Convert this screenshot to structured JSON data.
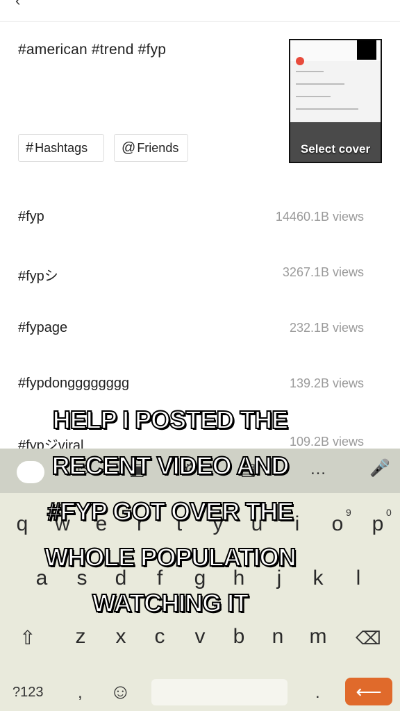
{
  "caption": "#american #trend #fyp",
  "cover": {
    "label": "Select cover"
  },
  "chips": {
    "hashtags": "Hashtags",
    "friends": "Friends"
  },
  "suggestions": [
    {
      "tag": "#fyp",
      "views": "14460.1B views"
    },
    {
      "tag": "#fypシ",
      "views": "3267.1B views"
    },
    {
      "tag": "#fypage",
      "views": "232.1B views"
    },
    {
      "tag": "#fypdongggggggg",
      "views": "139.2B views"
    },
    {
      "tag": "#fypジviral",
      "views": "109.2B views"
    }
  ],
  "keyboard": {
    "row1": [
      "q",
      "w",
      "e",
      "r",
      "t",
      "y",
      "u",
      "i",
      "o",
      "p"
    ],
    "row1_hints": {
      "o": "9",
      "p": "0"
    },
    "row2": [
      "a",
      "s",
      "d",
      "f",
      "g",
      "h",
      "j",
      "k",
      "l"
    ],
    "row3": [
      "z",
      "x",
      "c",
      "v",
      "b",
      "n",
      "m"
    ],
    "symbols_key": "?123",
    "comma_key": ",",
    "period_key": ".",
    "icons": [
      "back-icon",
      "sticker-icon",
      "gif-icon",
      "clipboard-icon",
      "more-icon",
      "mic-icon",
      "shift-icon",
      "backspace-icon",
      "emoji-icon",
      "enter-icon"
    ]
  },
  "overlay_text": [
    "HELP I POSTED THE",
    "RECENT VIDEO AND",
    "#FYP GOT OVER THE",
    "WHOLE POPULATION",
    "WATCHING IT"
  ]
}
